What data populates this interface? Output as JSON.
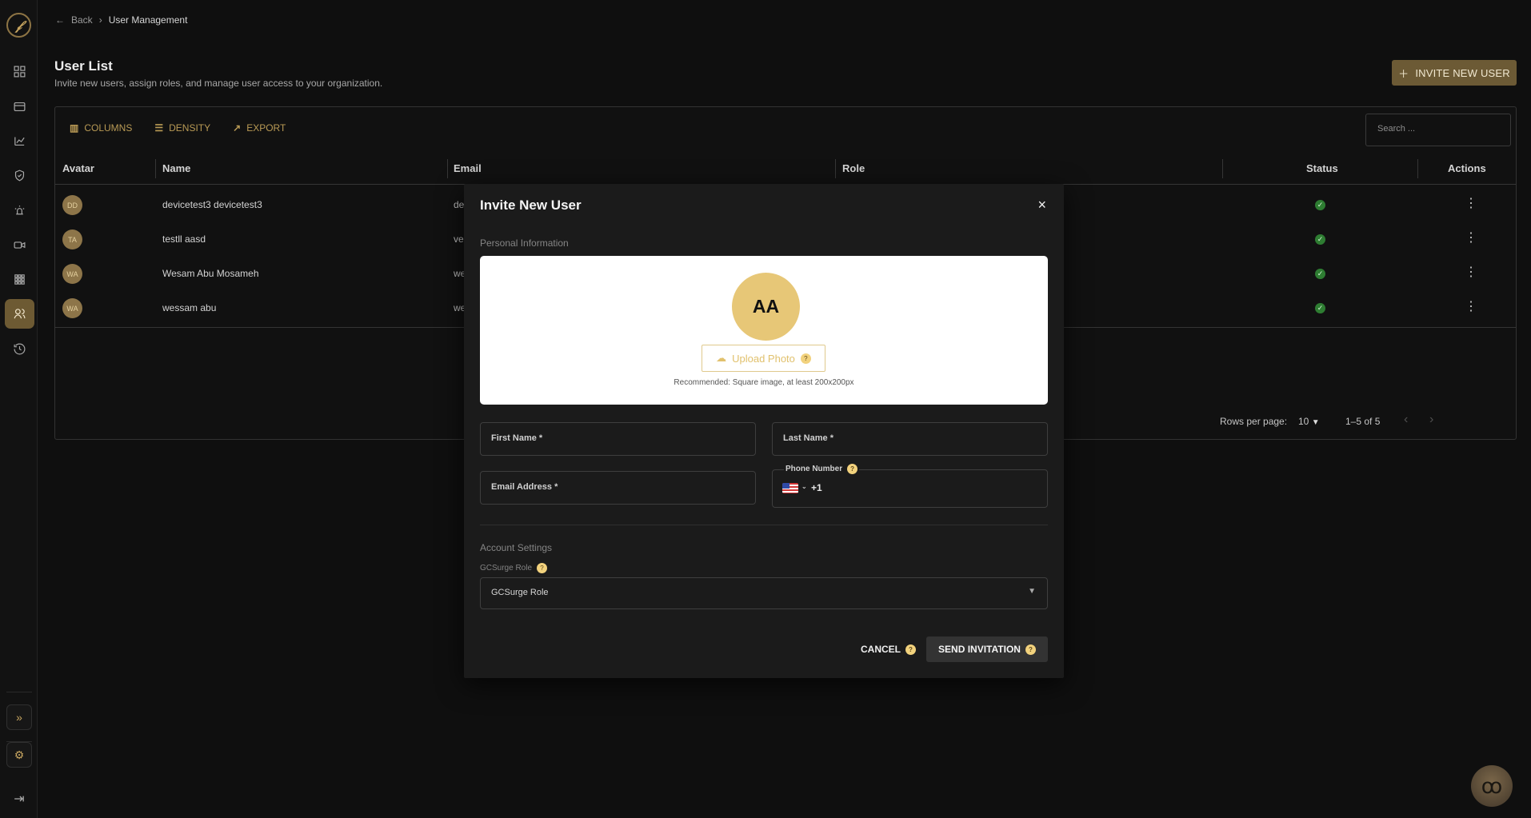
{
  "sidebar": {
    "logo": "𝒻",
    "items": [
      "dashboard-icon",
      "card-icon",
      "chart-icon",
      "shield-icon",
      "alarm-icon",
      "camera-icon",
      "grid-icon",
      "users-icon",
      "history-icon"
    ],
    "expand": "»",
    "settings": "⚙",
    "logout": "⇥"
  },
  "breadcrumb": {
    "back": "Back",
    "separator": "›",
    "current": "User Management"
  },
  "header": {
    "title": "User List",
    "subtitle": "Invite new users, assign roles, and manage user access to your organization.",
    "invite_label": "INVITE NEW USER"
  },
  "toolbar": {
    "columns": "COLUMNS",
    "density": "DENSITY",
    "export": "EXPORT",
    "search_placeholder": "Search ..."
  },
  "table": {
    "columns": [
      "Avatar",
      "Name",
      "Email",
      "Role",
      "Status",
      "Actions"
    ],
    "rows": [
      {
        "initials": "DD",
        "name": "devicetest3 devicetest3",
        "email": "de"
      },
      {
        "initials": "TA",
        "name": "testll aasd",
        "email": "ve"
      },
      {
        "initials": "WA",
        "name": "Wesam Abu Mosameh",
        "email": "we"
      },
      {
        "initials": "WA",
        "name": "wessam abu",
        "email": "we"
      }
    ],
    "rows_per_page_label": "Rows per page:",
    "rows_per_page_value": "10",
    "range": "1–5 of 5"
  },
  "modal": {
    "title": "Invite New User",
    "close": "×",
    "personal_info": "Personal Information",
    "avatar_initials": "AA",
    "upload_label": "Upload Photo",
    "recommendation": "Recommended: Square image, at least 200x200px",
    "first_name": "First Name *",
    "last_name": "Last Name *",
    "email": "Email Address *",
    "phone_label": "Phone Number",
    "phone_code": "+1",
    "account_settings": "Account Settings",
    "role_label": "GCSurge Role",
    "role_value": "GCSurge Role",
    "cancel": "CANCEL",
    "send": "SEND INVITATION"
  },
  "colors": {
    "accent": "#6d5a33",
    "gold": "#c8a660",
    "background": "#0f0f0f",
    "modal": "#1b1b1b"
  }
}
